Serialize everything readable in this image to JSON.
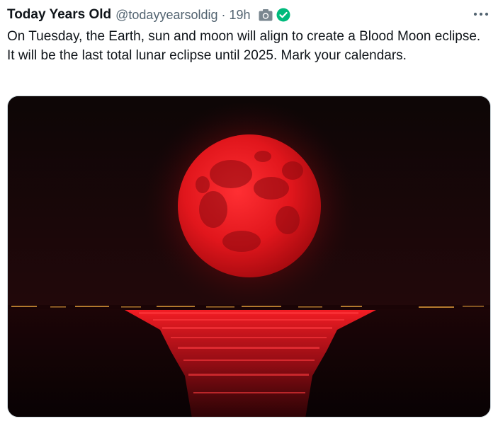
{
  "tweet": {
    "author_name": "Today Years Old",
    "handle": "@todayyearsoldig",
    "separator": "·",
    "timestamp": "19h",
    "icons": [
      "camera-icon",
      "verified-check-icon",
      "more-options-icon"
    ],
    "text": "On Tuesday, the Earth, sun and moon will align to create a Blood Moon eclipse. It will be the last total lunar eclipse until 2025. Mark your calendars.",
    "media": {
      "subject": "blood-moon-over-sea-photo"
    }
  },
  "colors": {
    "text_primary": "#0f1419",
    "text_secondary": "#536471",
    "verified_green": "#00ba7c",
    "moon_red": "#d4141a"
  }
}
